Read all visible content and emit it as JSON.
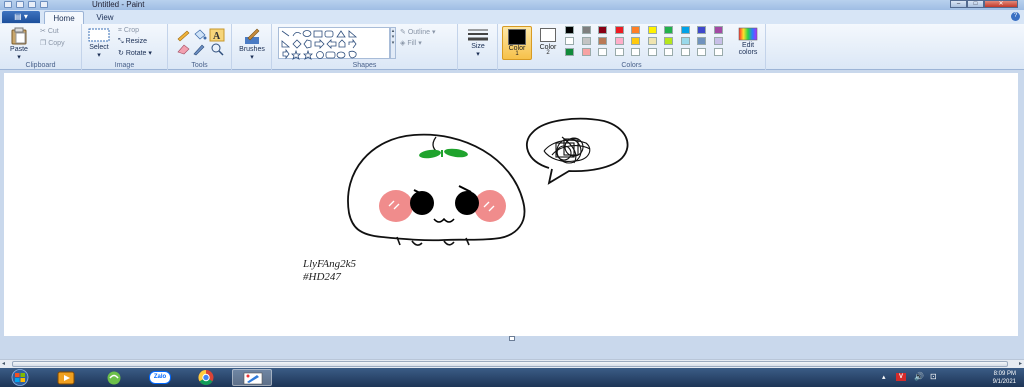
{
  "window": {
    "title": "Untitled - Paint"
  },
  "tabs": {
    "home": "Home",
    "view": "View"
  },
  "ribbon": {
    "clipboard": {
      "label": "Clipboard",
      "paste": "Paste",
      "cut": "Cut",
      "copy": "Copy"
    },
    "image": {
      "label": "Image",
      "select": "Select",
      "crop": "Crop",
      "resize": "Resize",
      "rotate": "Rotate"
    },
    "tools": {
      "label": "Tools"
    },
    "brushes": {
      "label": "Brushes"
    },
    "shapes": {
      "label": "Shapes",
      "outline": "Outline",
      "fill": "Fill"
    },
    "size": {
      "label": "Size"
    },
    "colors": {
      "label": "Colors",
      "color1": "Color",
      "color1_num": "1",
      "color2": "Color",
      "color2_num": "2",
      "edit1": "Edit",
      "edit2": "colors",
      "palette_row1": [
        "#000000",
        "#7f7f7f",
        "#880015",
        "#ed1c24",
        "#ff7f27",
        "#fff200",
        "#22b14c",
        "#00a2e8",
        "#3f48cc",
        "#a349a4"
      ],
      "palette_row2": [
        "#ffffff",
        "#c3c3c3",
        "#b97a57",
        "#ffaec9",
        "#ffc90e",
        "#efe4b0",
        "#b5e61d",
        "#99d9ea",
        "#7092be",
        "#c8bfe7"
      ],
      "palette_row3": [
        "#118a3a",
        "#f7a3a3",
        "#ffffff",
        "#ffffff",
        "#ffffff",
        "#ffffff",
        "#ffffff",
        "#ffffff",
        "#ffffff",
        "#ffffff"
      ]
    }
  },
  "canvas": {
    "signature_line1": "LlyFAng2k5",
    "signature_line2": "#HD247"
  },
  "taskbar": {
    "apps": [
      "start",
      "media-player",
      "app-green",
      "zalo",
      "chrome",
      "paint"
    ],
    "zalo_label": "Zalo"
  },
  "tray": {
    "time": "8:09 PM",
    "date": "9/1/2021"
  }
}
